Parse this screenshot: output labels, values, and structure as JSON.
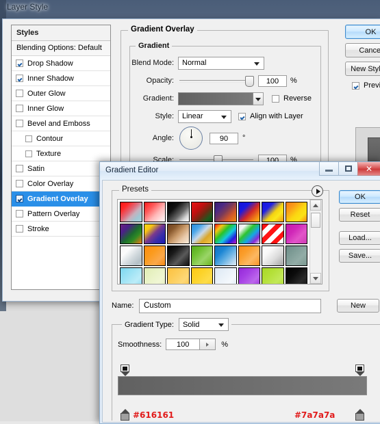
{
  "desktop": {
    "bg_color": "#dcdcdc",
    "wallpaper_color": "#54667f"
  },
  "layer_style": {
    "title": "Layer Style",
    "styles_panel": {
      "header": "Styles",
      "blending_options": "Blending Options: Default",
      "items": [
        {
          "label": "Drop Shadow",
          "checked": true,
          "indent": false,
          "selected": false
        },
        {
          "label": "Inner Shadow",
          "checked": true,
          "indent": false,
          "selected": false
        },
        {
          "label": "Outer Glow",
          "checked": false,
          "indent": false,
          "selected": false
        },
        {
          "label": "Inner Glow",
          "checked": false,
          "indent": false,
          "selected": false
        },
        {
          "label": "Bevel and Emboss",
          "checked": false,
          "indent": false,
          "selected": false
        },
        {
          "label": "Contour",
          "checked": false,
          "indent": true,
          "selected": false
        },
        {
          "label": "Texture",
          "checked": false,
          "indent": true,
          "selected": false
        },
        {
          "label": "Satin",
          "checked": false,
          "indent": false,
          "selected": false
        },
        {
          "label": "Color Overlay",
          "checked": false,
          "indent": false,
          "selected": false
        },
        {
          "label": "Gradient Overlay",
          "checked": true,
          "indent": false,
          "selected": true
        },
        {
          "label": "Pattern Overlay",
          "checked": false,
          "indent": false,
          "selected": false
        },
        {
          "label": "Stroke",
          "checked": false,
          "indent": false,
          "selected": false
        }
      ]
    },
    "section_title": "Gradient Overlay",
    "group_title": "Gradient",
    "fields": {
      "blend_mode_label": "Blend Mode:",
      "blend_mode_value": "Normal",
      "opacity_label": "Opacity:",
      "opacity_value": "100",
      "opacity_unit": "%",
      "gradient_label": "Gradient:",
      "gradient_from": "#616161",
      "gradient_to": "#7a7a7a",
      "reverse_label": "Reverse",
      "reverse_checked": false,
      "style_label": "Style:",
      "style_value": "Linear",
      "align_label": "Align with Layer",
      "align_checked": true,
      "angle_label": "Angle:",
      "angle_value": "90",
      "angle_unit": "°",
      "scale_label": "Scale:",
      "scale_value": "100",
      "scale_unit": "%"
    },
    "buttons": [
      {
        "label": "OK",
        "primary": true
      },
      {
        "label": "Cancel",
        "primary": false
      },
      {
        "label": "New Style...",
        "primary": false
      }
    ],
    "preview_label": "Preview",
    "preview_checked": true
  },
  "gradient_editor": {
    "title": "Gradient Editor",
    "window_buttons": {
      "minimize": "minimize-icon",
      "maximize": "maximize-icon",
      "close": "✕"
    },
    "presets": {
      "label": "Presets",
      "menu_icon": "preset-menu-arrow-icon",
      "swatches": [
        "linear-gradient(135deg,#ff1414 0%,#ff2a2a 22%,#e06a7a 45%,#c8b0bc 62%,#9fc7d4 80%,#a8cfd8 100%)",
        "linear-gradient(135deg,#ff1a1a 0%,#ff5a5a 30%,#ffb7b7 60%,#ffe3e3 85%,#fdf3f3 100%)",
        "linear-gradient(135deg,#000000 0%,#111111 30%,#6a6a6a 60%,#d8d8d8 82%,#ffffff 100%)",
        "linear-gradient(135deg,#e81414 0%,#c01010 35%,#6e2a12 60%,#1d5a1d 82%,#0f4a12 100%)",
        "linear-gradient(135deg,#3b1f6e 0%,#4a2a86 25%,#7a3a5a 48%,#d1582a 72%,#f08a10 100%)",
        "linear-gradient(135deg,#1414d8 0%,#1a1ae0 28%,#d02828 55%,#ef7a16 78%,#fbc014 100%)",
        "linear-gradient(135deg,#1414dc 0%,#2020e4 28%,#f5d211 55%,#fbe81c 72%,#f79a12 100%)",
        "linear-gradient(135deg,#f77c14 0%,#fa9a18 25%,#fbd711 55%,#fae216 75%,#f9880f 100%)",
        "linear-gradient(135deg,#6b2180 0%,#4a2088 25%,#1c6b2e 52%,#2f8a24 70%,#f07a16 100%)",
        "linear-gradient(135deg,#fbd714 0%,#f8c412 22%,#7a3a8e 48%,#3a2ea8 70%,#1b1bb4 100%)",
        "linear-gradient(135deg,#6b4020 0%,#8a5a2e 25%,#c99a6a 50%,#e8c8a8 72%,#f8ecdc 100%)",
        "linear-gradient(135deg,#2a8ad8 0%,#4aa6e8 25%,#c8d8e8 48%,#dba72a 70%,#f0c94a 100%)",
        "linear-gradient(135deg,#ff1414 0%,#f7c414 20%,#28c428 40%,#14c8e0 60%,#2020e0 80%,#c418c4 100%)",
        "linear-gradient(135deg,#e8e8e8 0%,#f4f4f4 18%,#2ec42e 40%,#14a8e4 62%,#8a2ad8 82%,#e0e0e0 100%)",
        "repeating-linear-gradient(135deg,#ff1414 0 7px,#ffffff 7px 14px)",
        "linear-gradient(135deg,#c418a8 0%,#d028b8 35%,#e254c8 65%,#ce3ab4 100%)",
        "linear-gradient(135deg,#f4f4f4 0%,#fcfcfc 28%,#d0d8dc 60%,#b4c0c6 85%,#c8d2d6 100%)",
        "linear-gradient(135deg,#ff8c0f 0%,#fb9a1c 35%,#fba84a 70%,#f98a14 100%)",
        "linear-gradient(135deg,#000000 0%,#1a1a1a 30%,#5a5a5a 62%,#2a2a2a 85%,#141414 100%)",
        "linear-gradient(135deg,#56a81c 0%,#6ec030 30%,#9ad468 62%,#7ec23c 85%,#62b028 100%)",
        "linear-gradient(135deg,#1470c0 0%,#1c86d4 30%,#6cb4e4 60%,#bcd8ee 85%,#d8e8f4 100%)",
        "linear-gradient(135deg,#f88c18 0%,#fa9e2c 32%,#fcb862 65%,#f99428 100%)",
        "linear-gradient(135deg,#ffffff 0%,#f8f8f8 30%,#dcdcdc 62%,#b8b8b8 86%,#a8a8a8 100%)",
        "linear-gradient(135deg,#6e8c88 0%,#7e9c96 32%,#92aca6 65%,#7a9890 100%)",
        "linear-gradient(135deg,#7cd8f0 0%,#9ce2f4 35%,#bcecf8 70%,#8ddcf2 100%)",
        "linear-gradient(135deg,#e0ecb4 0%,#e8f2c4 35%,#f0f6d4 70%,#e4eebc 100%)",
        "linear-gradient(135deg,#fbc040 0%,#fccc58 35%,#fdd878 70%,#fbc648 100%)",
        "linear-gradient(135deg,#fbc814 0%,#fcd228 35%,#fddc48 70%,#fbcc1c 100%)",
        "linear-gradient(135deg,#dce8f4 0%,#e8f0f8 35%,#f4f8fc 70%,#e0ecf6 100%)",
        "linear-gradient(135deg,#9428d8 0%,#a640e4 35%,#bc68ec 70%,#9c30dc 100%)",
        "linear-gradient(135deg,#a8d828 0%,#b4e038 35%,#c2e858 70%,#acdc2c 100%)",
        "linear-gradient(135deg,#000000 0%,#0c0c0c 35%,#2a2a2a 70%,#141414 100%)"
      ]
    },
    "buttons": [
      {
        "label": "OK",
        "primary": true
      },
      {
        "label": "Reset",
        "primary": false
      },
      {
        "label": "Load...",
        "primary": false
      },
      {
        "label": "Save...",
        "primary": false
      }
    ],
    "name_label": "Name:",
    "name_value": "Custom",
    "new_button": "New",
    "gradient_type_label": "Gradient Type:",
    "gradient_type_value": "Solid",
    "smoothness_label": "Smoothness:",
    "smoothness_value": "100",
    "smoothness_unit": "%",
    "stop_left_hex": "#616161",
    "stop_right_hex": "#7a7a7a",
    "stop_hex_color": "#e11b1b"
  }
}
